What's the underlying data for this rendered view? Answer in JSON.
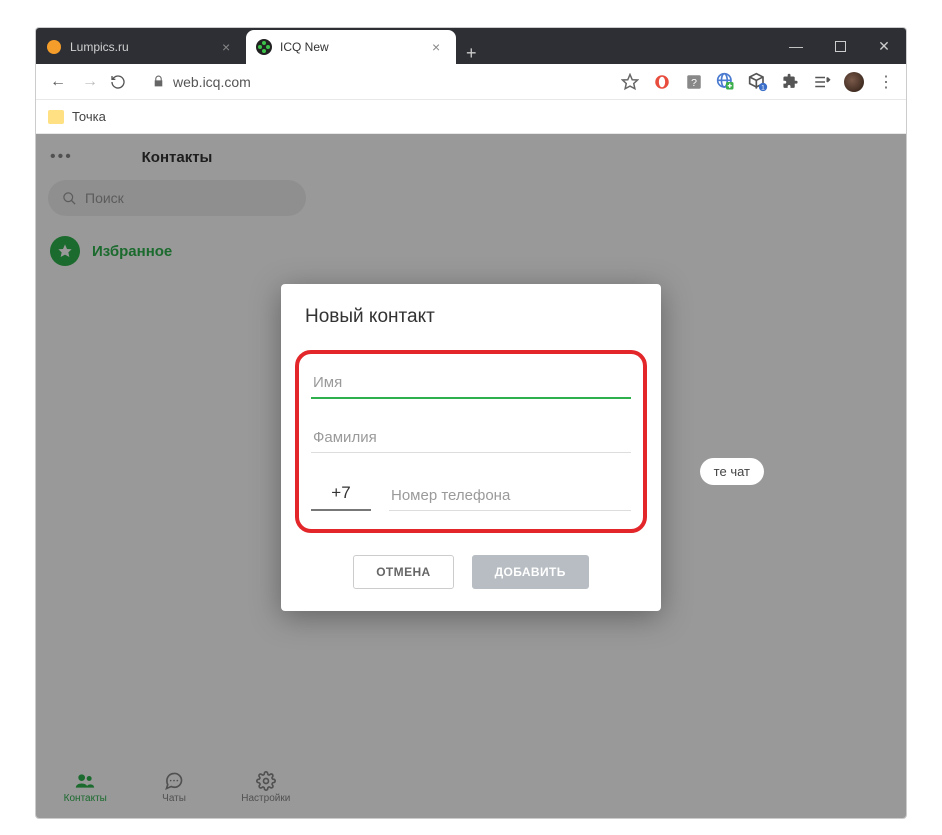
{
  "browser": {
    "tabs": [
      {
        "title": "Lumpics.ru",
        "favicon_color": "#f59d2a"
      },
      {
        "title": "ICQ New",
        "favicon_color": "#3cc24a"
      }
    ],
    "url_host": "web.icq.com",
    "bookmark_label": "Точка"
  },
  "sidebar": {
    "title": "Контакты",
    "search_placeholder": "Поиск",
    "favorites_label": "Избранное"
  },
  "main": {
    "hint_chip": "те чат"
  },
  "bottom_nav": {
    "contacts": "Контакты",
    "chats": "Чаты",
    "settings": "Настройки"
  },
  "modal": {
    "title": "Новый контакт",
    "first_name_placeholder": "Имя",
    "last_name_placeholder": "Фамилия",
    "phone_prefix_value": "+7",
    "phone_placeholder": "Номер телефона",
    "cancel_label": "ОТМЕНА",
    "submit_label": "ДОБАВИТЬ"
  }
}
